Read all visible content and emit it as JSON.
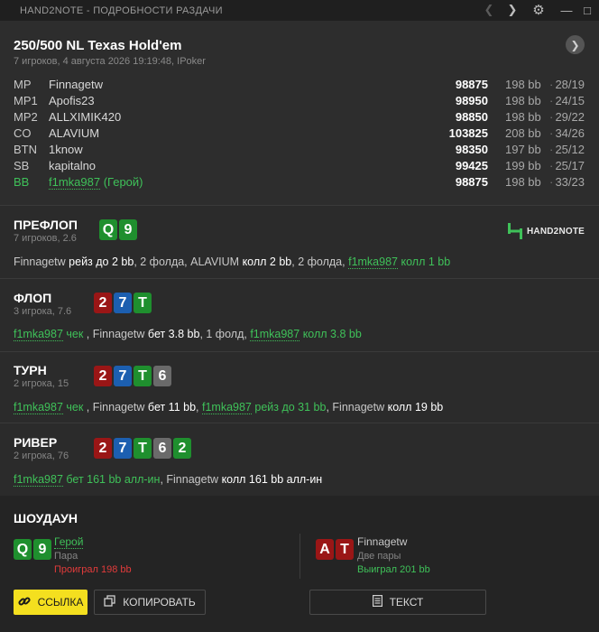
{
  "window": {
    "title": "HAND2NOTE - ПОДРОБНОСТИ РАЗДАЧИ"
  },
  "hand": {
    "title": "250/500 NL Texas Hold'em",
    "subtitle": "7 игроков, 4 августа 2026 19:19:48, IPoker"
  },
  "players": [
    {
      "pos": "MP",
      "name": "Finnagetw",
      "stack": "98875",
      "bb": "198 bb",
      "sep": "·",
      "stat": "28/19"
    },
    {
      "pos": "MP1",
      "name": "Apofis23",
      "stack": "98950",
      "bb": "198 bb",
      "sep": "·",
      "stat": "24/15"
    },
    {
      "pos": "MP2",
      "name": "ALLXIMIK420",
      "stack": "98850",
      "bb": "198 bb",
      "sep": "·",
      "stat": "29/22"
    },
    {
      "pos": "CO",
      "name": "ALAVIUM",
      "stack": "103825",
      "bb": "208 bb",
      "sep": "·",
      "stat": "34/26"
    },
    {
      "pos": "BTN",
      "name": "1know",
      "stack": "98350",
      "bb": "197 bb",
      "sep": "·",
      "stat": "25/12"
    },
    {
      "pos": "SB",
      "name": "kapitalno",
      "stack": "99425",
      "bb": "199 bb",
      "sep": "·",
      "stat": "25/17"
    },
    {
      "pos": "BB",
      "name": "f1mka987",
      "hero_tag": "(Герой)",
      "stack": "98875",
      "bb": "198 bb",
      "sep": "·",
      "stat": "33/23"
    }
  ],
  "logo": {
    "text": "HAND2NOTE"
  },
  "streets": {
    "preflop": {
      "name": "ПРЕФЛОП",
      "sub": "7 игроков, 2.6",
      "cards": [
        {
          "v": "Q",
          "c": "#1f8f2e"
        },
        {
          "v": "9",
          "c": "#1f8f2e"
        }
      ],
      "actions": {
        "p1": "Finnagetw",
        "a1": "рейз до 2 bb",
        "t1": ", 2 фолда, ",
        "p2": "ALAVIUM",
        "a2": "колл 2 bb",
        "t2": ", 2 фолда, ",
        "p3": "f1mka987",
        "a3": "колл 1 bb"
      }
    },
    "flop": {
      "name": "ФЛОП",
      "sub": "3 игрока, 7.6",
      "cards": [
        {
          "v": "2",
          "c": "#9a1616"
        },
        {
          "v": "7",
          "c": "#1c5fb0"
        },
        {
          "v": "T",
          "c": "#1f8f2e"
        }
      ],
      "actions": {
        "p1": "f1mka987",
        "a1": "чек",
        "t1": " , ",
        "p2": "Finnagetw",
        "a2": "бет 3.8 bb",
        "t2": ", 1 фолд, ",
        "p3": "f1mka987",
        "a3": "колл 3.8 bb"
      }
    },
    "turn": {
      "name": "ТУРН",
      "sub": "2 игрока, 15",
      "cards": [
        {
          "v": "2",
          "c": "#9a1616"
        },
        {
          "v": "7",
          "c": "#1c5fb0"
        },
        {
          "v": "T",
          "c": "#1f8f2e"
        },
        {
          "v": "6",
          "c": "#6a6a6a"
        }
      ],
      "actions": {
        "p1": "f1mka987",
        "a1": "чек",
        "t1": " , ",
        "p2": "Finnagetw",
        "a2": "бет 11 bb",
        "t2": ", ",
        "p3": "f1mka987",
        "a3": "рейз до 31 bb",
        "t3": ", ",
        "p4": "Finnagetw",
        "a4": "колл 19 bb"
      }
    },
    "river": {
      "name": "РИВЕР",
      "sub": "2 игрока, 76",
      "cards": [
        {
          "v": "2",
          "c": "#9a1616"
        },
        {
          "v": "7",
          "c": "#1c5fb0"
        },
        {
          "v": "T",
          "c": "#1f8f2e"
        },
        {
          "v": "6",
          "c": "#6a6a6a"
        },
        {
          "v": "2",
          "c": "#1f8f2e"
        }
      ],
      "actions": {
        "p1": "f1mka987",
        "a1": "бет 161 bb алл-ин",
        "t1": ", ",
        "p2": "Finnagetw",
        "a2": "колл 161 bb алл-ин"
      }
    }
  },
  "showdown": {
    "title": "ШОУДАУН",
    "hero": {
      "name": "Герой",
      "combo": "Пара",
      "result": "Проиграл 198 bb",
      "cards": [
        {
          "v": "Q",
          "c": "#1f8f2e"
        },
        {
          "v": "9",
          "c": "#1f8f2e"
        }
      ]
    },
    "villain": {
      "name": "Finnagetw",
      "combo": "Две пары",
      "result": "Выиграл 201 bb",
      "cards": [
        {
          "v": "A",
          "c": "#9a1616"
        },
        {
          "v": "T",
          "c": "#9a1616"
        }
      ]
    }
  },
  "buttons": {
    "link": "ССЫЛКА",
    "copy": "КОПИРОВАТЬ",
    "text": "ТЕКСТ"
  },
  "colors": {
    "hero": "#3fc159",
    "accent": "#f4df1f",
    "lost": "#e23b3b",
    "won": "#3fc159"
  }
}
